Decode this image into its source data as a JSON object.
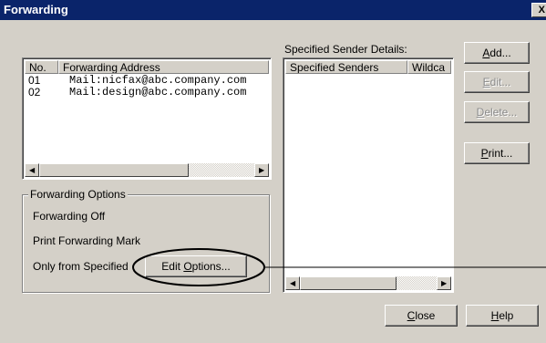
{
  "window": {
    "title": "Forwarding",
    "close_glyph": "X"
  },
  "forwarding_list": {
    "columns": [
      "No.",
      "Forwarding Address"
    ],
    "rows": [
      {
        "no": "01",
        "address": "Mail:nicfax@abc.company.com"
      },
      {
        "no": "02",
        "address": "Mail:design@abc.company.com"
      }
    ]
  },
  "specified_sender": {
    "label": "Specified Sender Details:",
    "columns": [
      "Specified Senders",
      "Wildca"
    ]
  },
  "side_buttons": {
    "add": {
      "pre": "",
      "mnemonic": "A",
      "post": "dd..."
    },
    "edit": {
      "pre": "",
      "mnemonic": "E",
      "post": "dit..."
    },
    "delete": {
      "pre": "",
      "mnemonic": "D",
      "post": "elete..."
    },
    "print": {
      "pre": "",
      "mnemonic": "P",
      "post": "rint..."
    }
  },
  "forwarding_options": {
    "legend": "Forwarding Options",
    "items": [
      "Forwarding Off",
      "Print Forwarding Mark",
      "Only from Specified"
    ],
    "edit_options": {
      "pre": "Edit ",
      "mnemonic": "O",
      "post": "ptions..."
    }
  },
  "bottom_buttons": {
    "close": {
      "pre": "",
      "mnemonic": "C",
      "post": "lose"
    },
    "help": {
      "pre": "",
      "mnemonic": "H",
      "post": "elp"
    }
  },
  "colors": {
    "titlebar": "#0a246a",
    "face": "#d4d0c8",
    "callout": "#000000"
  }
}
